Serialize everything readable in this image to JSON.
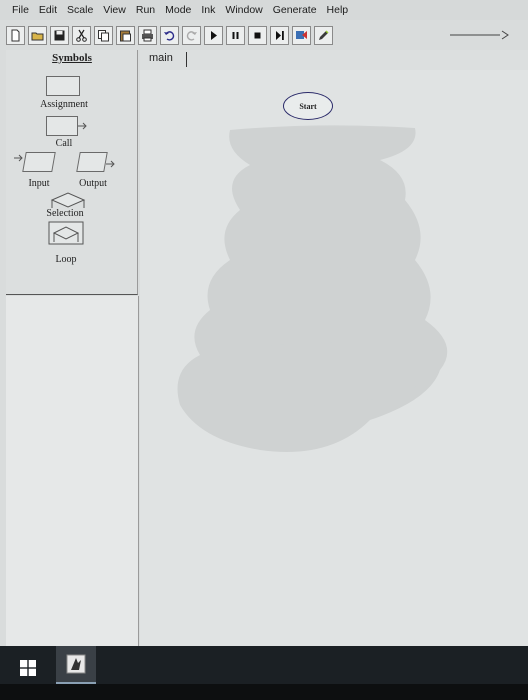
{
  "menu": [
    "File",
    "Edit",
    "Scale",
    "View",
    "Run",
    "Mode",
    "Ink",
    "Window",
    "Generate",
    "Help"
  ],
  "toolbar": {
    "icons": [
      "new-file-icon",
      "open-folder-icon",
      "save-icon",
      "cut-icon",
      "copy-icon",
      "paste-icon",
      "print-icon",
      "undo-icon",
      "redo-icon",
      "play-icon",
      "pause-icon",
      "stop-icon",
      "step-icon",
      "test-icon",
      "pen-icon"
    ]
  },
  "symbols": {
    "heading": "Symbols",
    "assignment": "Assignment",
    "call": "Call",
    "input": "Input",
    "output": "Output",
    "selection": "Selection",
    "loop": "Loop"
  },
  "tab": {
    "label": "main"
  },
  "flowchart": {
    "start_label": "Start"
  },
  "colors": {
    "scribble": "#cfd2d2",
    "start_border": "#2b2b6a",
    "taskbar": "#1b2024"
  }
}
